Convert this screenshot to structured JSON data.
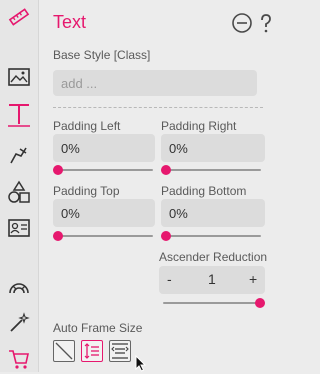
{
  "panel": {
    "title": "Text",
    "accent_color": "#e6186e",
    "base_style": {
      "label": "Base Style [Class]",
      "placeholder": "add ..."
    },
    "padding": {
      "left": {
        "label": "Padding Left",
        "value": "0%",
        "slider_fraction": 0
      },
      "right": {
        "label": "Padding Right",
        "value": "0%",
        "slider_fraction": 0
      },
      "top": {
        "label": "Padding Top",
        "value": "0%",
        "slider_fraction": 0
      },
      "bottom": {
        "label": "Padding Bottom",
        "value": "0%",
        "slider_fraction": 0
      }
    },
    "ascender": {
      "label": "Ascender Reduction",
      "minus": "-",
      "value": "1",
      "plus": "+",
      "slider_fraction": 1
    },
    "auto_frame": {
      "label": "Auto Frame Size"
    }
  },
  "sidebar": {
    "items": [
      "ruler-icon",
      "image-icon",
      "text-icon",
      "pen-icon",
      "shapes-icon",
      "contact-card-icon",
      "rainbow-icon",
      "magic-wand-icon",
      "cart-icon"
    ],
    "active": "text-icon"
  },
  "header_icons": [
    "minus-circle-icon",
    "help-icon"
  ]
}
